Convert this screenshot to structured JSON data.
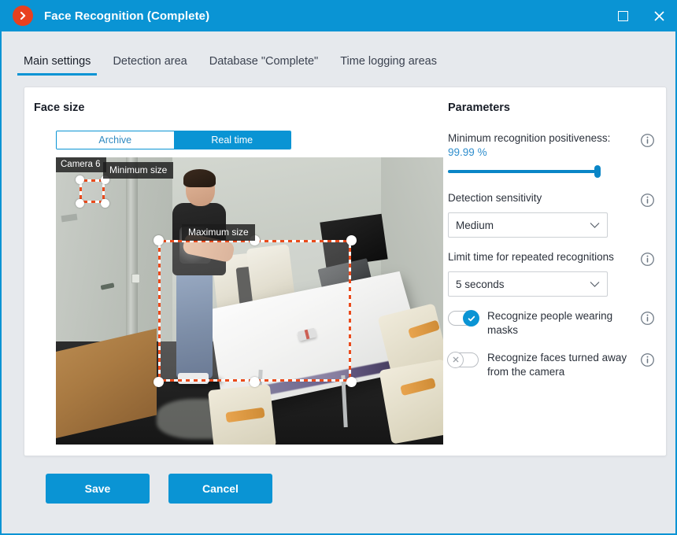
{
  "window": {
    "title": "Face Recognition (Complete)",
    "app_icon": "chevron-right-circle-icon",
    "maximize_label": "Maximize",
    "close_label": "Close",
    "accent_color": "#0a94d4",
    "icon_color": "#e8401f"
  },
  "tabs": [
    {
      "label": "Main settings",
      "active": true
    },
    {
      "label": "Detection area",
      "active": false
    },
    {
      "label": "Database \"Complete\"",
      "active": false
    },
    {
      "label": "Time logging areas",
      "active": false
    }
  ],
  "face_size": {
    "title": "Face size",
    "segmented": {
      "options": [
        "Archive",
        "Real time"
      ],
      "selected": "Real time"
    },
    "video": {
      "camera_label": "Camera 6",
      "min_size_label": "Minimum size",
      "max_size_label": "Maximum size",
      "box_color": "#ea4b1c"
    }
  },
  "parameters": {
    "title": "Parameters",
    "positiveness": {
      "label": "Minimum recognition positiveness:",
      "value": "99.99",
      "unit": "%",
      "slider_percent": 100,
      "value_color": "#2f8ecd"
    },
    "detection_sensitivity": {
      "label": "Detection sensitivity",
      "value": "Medium"
    },
    "limit_time": {
      "label": "Limit time for repeated recognitions",
      "value": "5 seconds"
    },
    "toggles": [
      {
        "label": "Recognize people wearing masks",
        "state": "on",
        "glyph": "check-icon"
      },
      {
        "label": "Recognize faces turned away from the camera",
        "state": "off",
        "glyph": "x-icon"
      }
    ],
    "info_icon": "info-icon"
  },
  "footer": {
    "save_label": "Save",
    "cancel_label": "Cancel"
  }
}
